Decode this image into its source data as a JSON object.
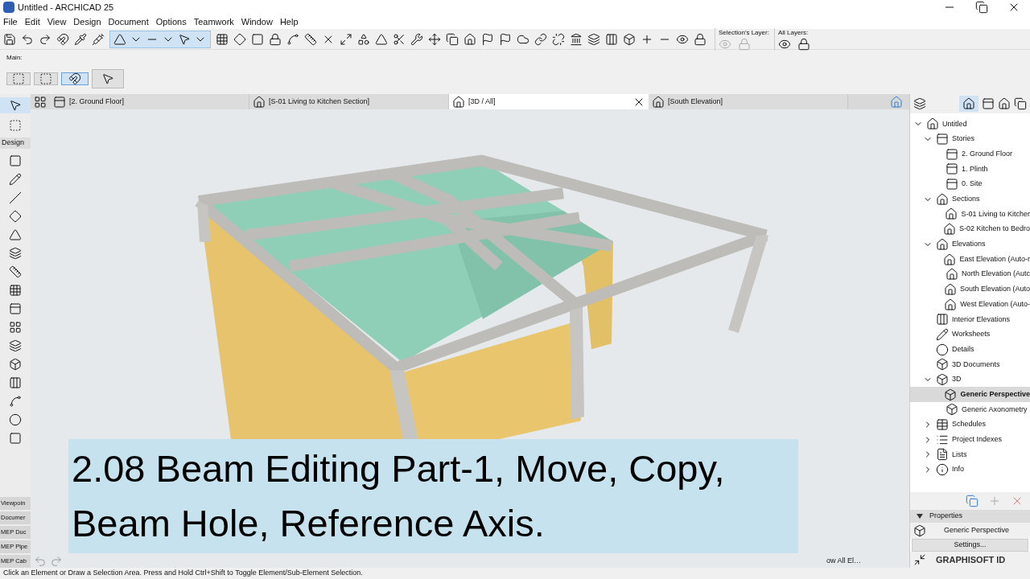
{
  "window": {
    "title": "Untitled - ARCHICAD 25"
  },
  "menu": [
    "File",
    "Edit",
    "View",
    "Design",
    "Document",
    "Options",
    "Teamwork",
    "Window",
    "Help"
  ],
  "toolbar": {
    "selection_layer_label": "Selection's Layer:",
    "all_layers_label": "All Layers:"
  },
  "info_box": {
    "label": "Main:"
  },
  "toolbox": {
    "section": "Design",
    "palettes": [
      "Viewpoin",
      "Documer",
      "MEP Duc",
      "MEP Pipe",
      "MEP Cab"
    ]
  },
  "tabs": [
    {
      "label": "[2. Ground Floor]",
      "kind": "plan",
      "selected": false
    },
    {
      "label": "[S-01 Living to Kitchen Section]",
      "kind": "section",
      "selected": false
    },
    {
      "label": "[3D / All]",
      "kind": "perspective",
      "selected": true
    },
    {
      "label": "[South Elevation]",
      "kind": "elevation",
      "selected": false
    }
  ],
  "view": {
    "bottom_text": "ow All El…"
  },
  "navigator": {
    "tree": [
      {
        "label": "Untitled",
        "kind": "project",
        "expanded": true,
        "selected": false,
        "children": [
          {
            "label": "Stories",
            "kind": "story",
            "expanded": true,
            "selected": false,
            "children": [
              {
                "label": "2. Ground Floor",
                "kind": "story",
                "selected": false
              },
              {
                "label": "1. Plinth",
                "kind": "story",
                "selected": false
              },
              {
                "label": "0. Site",
                "kind": "story",
                "selected": false
              }
            ]
          },
          {
            "label": "Sections",
            "kind": "section",
            "expanded": true,
            "selected": false,
            "children": [
              {
                "label": "S-01 Living to Kitcher",
                "kind": "section",
                "selected": false
              },
              {
                "label": "S-02 Kitchen to Bedro",
                "kind": "section",
                "selected": false
              }
            ]
          },
          {
            "label": "Elevations",
            "kind": "elevation",
            "expanded": true,
            "selected": false,
            "children": [
              {
                "label": "East Elevation (Auto-r",
                "kind": "elevation",
                "selected": false
              },
              {
                "label": "North Elevation (Autc",
                "kind": "elevation",
                "selected": false
              },
              {
                "label": "South Elevation (Auto",
                "kind": "elevation",
                "selected": false
              },
              {
                "label": "West Elevation (Auto-",
                "kind": "elevation",
                "selected": false
              }
            ]
          },
          {
            "label": "Interior Elevations",
            "kind": "interior",
            "selected": false
          },
          {
            "label": "Worksheets",
            "kind": "worksheet",
            "selected": false
          },
          {
            "label": "Details",
            "kind": "detail",
            "selected": false
          },
          {
            "label": "3D Documents",
            "kind": "doc3d",
            "selected": false
          },
          {
            "label": "3D",
            "kind": "perspective",
            "expanded": true,
            "selected": false,
            "children": [
              {
                "label": "Generic Perspective",
                "kind": "perspective",
                "selected": true
              },
              {
                "label": "Generic Axonometry",
                "kind": "axo",
                "selected": false
              }
            ]
          },
          {
            "label": "Schedules",
            "kind": "schedule",
            "expanded": false,
            "selected": false
          },
          {
            "label": "Project Indexes",
            "kind": "index",
            "expanded": false,
            "selected": false
          },
          {
            "label": "Lists",
            "kind": "list",
            "expanded": false,
            "selected": false
          },
          {
            "label": "Info",
            "kind": "info",
            "expanded": false,
            "selected": false
          }
        ]
      }
    ],
    "properties_title": "Properties",
    "properties_value": "Generic Perspective",
    "settings_button": "Settings...",
    "footer": "GRAPHISOFT ID"
  },
  "caption": {
    "lines": [
      "2.08 Beam Editing Part-1, Move, Copy,",
      "Beam Hole, Reference Axis."
    ]
  },
  "status_bar": "Click an Element or Draw a Selection Area. Press and Hold Ctrl+Shift to Toggle Element/Sub-Element Selection."
}
